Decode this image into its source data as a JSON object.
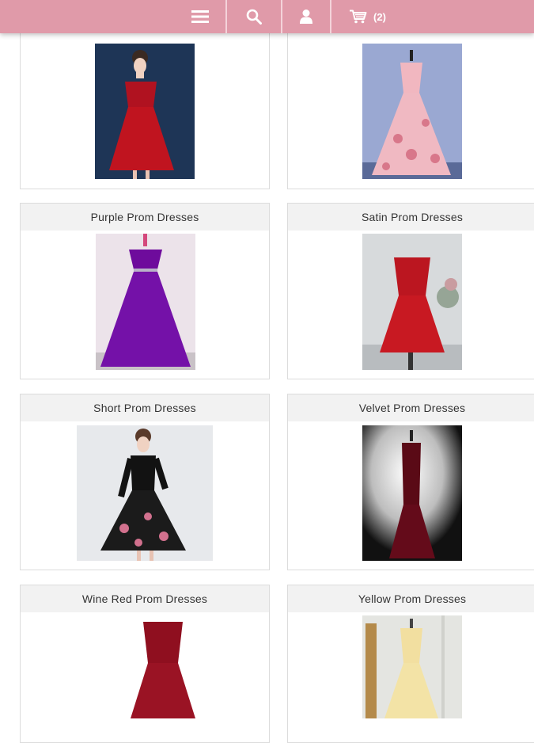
{
  "nav": {
    "menu_icon": "hamburger-menu-icon",
    "search_icon": "search-icon",
    "account_icon": "user-icon",
    "cart_icon": "shopping-cart-icon",
    "cart_count": "(2)",
    "bar_color": "#e09aa9"
  },
  "products": [
    {
      "title": "",
      "image": "red off-shoulder short dress"
    },
    {
      "title": "",
      "image": "pink floral ball gown"
    },
    {
      "title": "Purple Prom Dresses",
      "image": "purple ball gown"
    },
    {
      "title": "Satin Prom Dresses",
      "image": "red satin short dress"
    },
    {
      "title": "Short Prom Dresses",
      "image": "black and pink lace dress"
    },
    {
      "title": "Velvet Prom Dresses",
      "image": "burgundy velvet mermaid gown"
    },
    {
      "title": "Wine Red Prom Dresses",
      "image": "wine red dress"
    },
    {
      "title": "Yellow Prom Dresses",
      "image": "yellow gown"
    }
  ]
}
